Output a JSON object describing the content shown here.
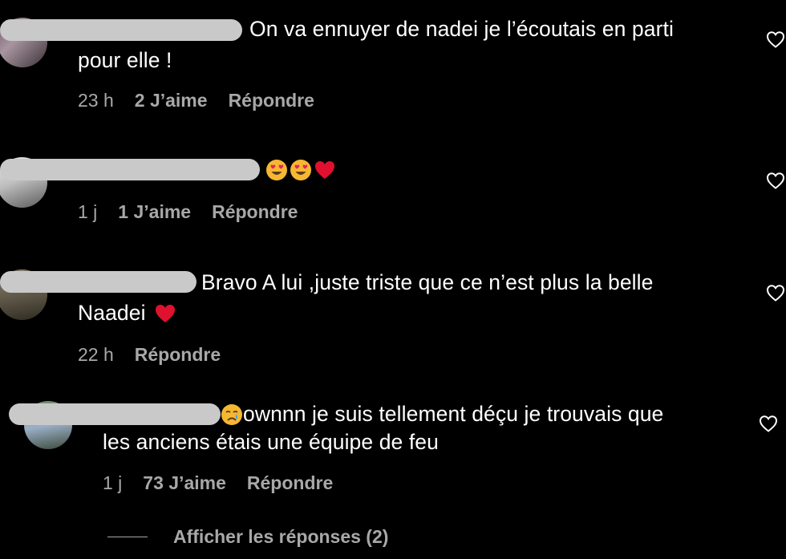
{
  "comments": [
    {
      "text_line1": "On va ennuyer de nadei je l’écoutais en parti",
      "text_line2": "pour elle !",
      "time": "23 h",
      "likes": "2 J’aime",
      "reply": "Répondre"
    },
    {
      "text_line1": "",
      "time": "1 j",
      "likes": "1 J’aime",
      "reply": "Répondre"
    },
    {
      "text_line1": "Bravo A lui ,juste triste que ce n’est plus la belle",
      "text_line2": "Naadei",
      "time": "22 h",
      "reply": "Répondre"
    },
    {
      "text_line1": "ownnn je suis tellement déçu je trouvais que",
      "text_line2": "les anciens étais une équipe de feu",
      "time": "1 j",
      "likes": "73 J’aime",
      "reply": "Répondre"
    }
  ],
  "view_replies": "Afficher les réponses (2)",
  "icons": {
    "like": "heart-outline-icon",
    "emoji_heart_eyes": "heart-eyes-emoji",
    "emoji_red_heart": "red-heart-emoji",
    "emoji_crying": "crying-face-emoji"
  },
  "colors": {
    "background": "#000000",
    "text": "#ffffff",
    "meta": "#a8a8a8",
    "redaction": "#c9c9c9"
  }
}
